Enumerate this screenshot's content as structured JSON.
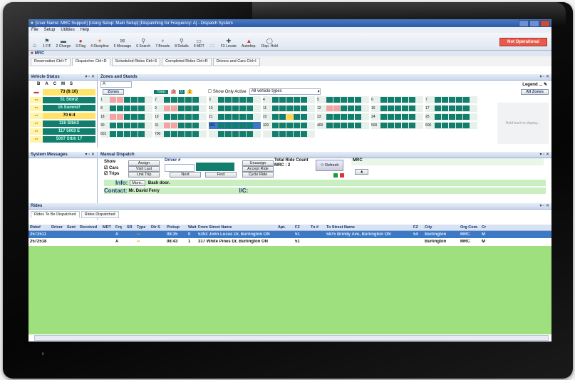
{
  "window": {
    "title": "[User Name: MRC Support] [Using Setup: Main Setup] [Dispatching for Frequency: A] - Dispatch System"
  },
  "menu": [
    "File",
    "Setup",
    "Utilities",
    "Help"
  ],
  "toolbar": {
    "items": [
      {
        "label": "1 F/F",
        "icon": "flag-icon"
      },
      {
        "label": "2 Charge",
        "icon": "charge-icon"
      },
      {
        "label": "3 Flag",
        "icon": "flag-icon"
      },
      {
        "label": "4 Discipline",
        "icon": "discipline-icon"
      },
      {
        "label": "5 Message",
        "icon": "message-icon"
      },
      {
        "label": "6 Search",
        "icon": "search-icon"
      },
      {
        "label": "7 Broadc",
        "icon": "broadcast-icon"
      },
      {
        "label": "8 Details",
        "icon": "details-icon"
      },
      {
        "label": "9 MDT",
        "icon": "mdt-icon"
      },
      {
        "label": "",
        "icon": "blank-icon"
      },
      {
        "label": "F3 Locate",
        "icon": "locate-icon"
      },
      {
        "label": "Autodisp.",
        "icon": "autodispatch-icon"
      },
      {
        "label": "Disp. Hold",
        "icon": "hold-icon"
      }
    ],
    "status": "Not Operational"
  },
  "company": "MRC",
  "tabs": [
    "Reservation Ctrl+T",
    "Dispatcher Ctrl+D",
    "Scheduled Rides Ctrl+S",
    "Completed Rides Ctrl+R",
    "Drivers and Cars Ctrl+I"
  ],
  "vehicle_status": {
    "title": "Vehicle Status",
    "columns": [
      "B",
      "A",
      "C",
      "M",
      "S"
    ],
    "rows": [
      {
        "text": "73 (6:10)",
        "color": "#ffe36b",
        "fg": "#000"
      },
      {
        "text": "51 Stbh2",
        "color": "#127e6d",
        "fg": "#bfe"
      },
      {
        "text": "16 Summi7",
        "color": "#127e6d",
        "fg": "#bfe"
      },
      {
        "text": "70 6:4",
        "color": "#ffe36b",
        "fg": "#000"
      },
      {
        "text": "116 Stbh3",
        "color": "#127e6d",
        "fg": "#bfe"
      },
      {
        "text": "117 5003 E",
        "color": "#127e6d",
        "fg": "#bfe"
      },
      {
        "text": "5007 Stbh 17",
        "color": "#127e6d",
        "fg": "#bfe"
      }
    ]
  },
  "zones": {
    "title": "Zones and Stands",
    "filter": "A",
    "zones_button": "Zones",
    "total_label": "Total",
    "totals": [
      "3",
      "0",
      "2"
    ],
    "show_only_active": "Show Only Active",
    "vehicle_types": "All vehicle types",
    "legend": "Legend",
    "all_zones": "All Zones",
    "rows": [
      [
        "1",
        "2",
        "3",
        "4",
        "5",
        "6",
        "7"
      ],
      [
        "8",
        "9",
        "10",
        "11",
        "12",
        "16",
        "17"
      ],
      [
        "18",
        "19",
        "21",
        "22",
        "23",
        "24",
        "25"
      ],
      [
        "30",
        "31",
        "300",
        "320",
        "400",
        "500",
        "600"
      ],
      [
        "601",
        "700",
        "",
        ""
      ]
    ],
    "side_note": "Hold back to display..."
  },
  "system_messages": {
    "title": "System Messages"
  },
  "manual_dispatch": {
    "title": "Manual Dispatch",
    "show_label": "Show",
    "cars": "Cars",
    "trips": "Trips",
    "buttons": [
      "Assign",
      "Visit Last",
      "Link Trip",
      "Next",
      "Find",
      "Cycle Ride"
    ],
    "driver_label": "Driver #",
    "unassign": "Unassign",
    "accept_ride": "Accept Ride",
    "cycle_ride": "Cycle Ride",
    "total_ride_count": "Total Ride Count",
    "mrc_count": "MRC : 2",
    "refresh": "Refresh",
    "mrc_label": "MRC",
    "info_label": "Info:",
    "info_more": "More..",
    "info_text": "Back door.",
    "contact_label": "Contact:",
    "contact_value": "Mr. David Ferry",
    "ic_label": "I/C:"
  },
  "rides": {
    "title": "Rides",
    "tabs": [
      "Rides To Be Dispatched",
      "Rides Dispatched"
    ],
    "columns": [
      "Ride#",
      "Driver",
      "Sent",
      "Received",
      "MDT",
      "Frq",
      "SR",
      "Type",
      "Dir S",
      "Pickup",
      "Wait",
      "From Street Name",
      "Apt.",
      "FZ",
      "To #",
      "To Street Name",
      "FZ",
      "City",
      "Org Com.",
      "Cr"
    ],
    "rows": [
      {
        "id": "2572511",
        "frq": "A",
        "pickup": "08:35",
        "wait": "0",
        "from": "5353 John Lucas Dr, Burlington ON",
        "fz": "51",
        "to": "5875 Brindy Ave, Burlington ON",
        "tz": "54",
        "city": "Burlington",
        "org": "MRC",
        "cr": "M"
      },
      {
        "id": "2572518",
        "frq": "A",
        "pickup": "08:43",
        "wait": "1",
        "from": "317 White Pines Dr, Burlington ON",
        "fz": "51",
        "to": "",
        "tz": "",
        "city": "Burlington",
        "org": "MRC",
        "cr": "M"
      }
    ]
  },
  "colors": {
    "accent": "#2d5aa8",
    "selected_row": "#3b79c6",
    "stand_green": "#127e6d",
    "rides_bg": "#9ee07d",
    "alert": "#e85a4a"
  }
}
